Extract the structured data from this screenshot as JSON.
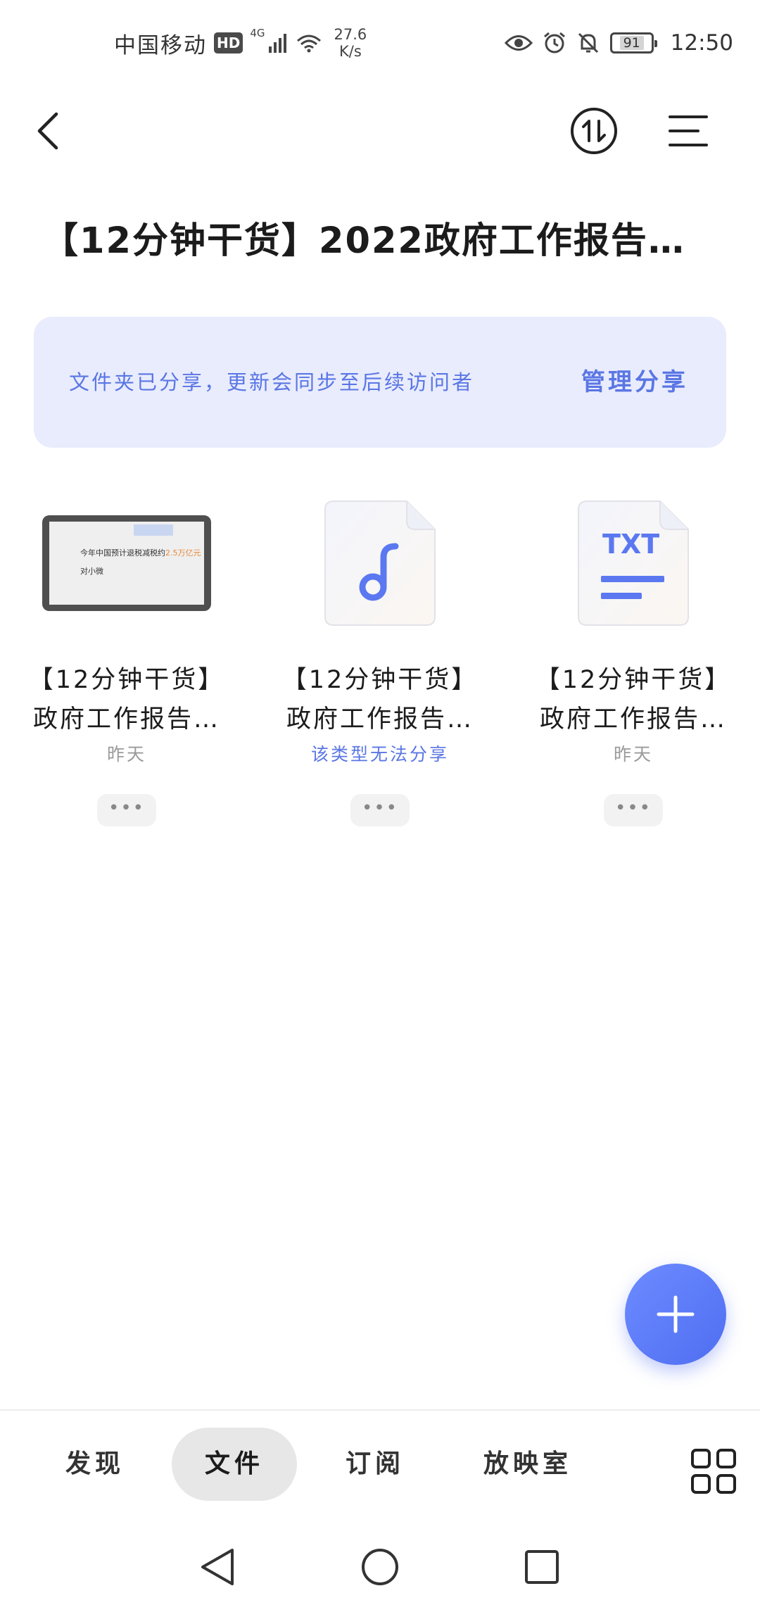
{
  "status_bar": {
    "carrier": "中国移动",
    "hd_label": "HD",
    "network_type": "4G",
    "speed_value": "27.6",
    "speed_unit": "K/s",
    "battery_level": "91",
    "time": "12:50"
  },
  "header": {
    "title": "【12分钟干货】2022政府工作报告…"
  },
  "share_banner": {
    "notice": "文件夹已分享，更新会同步至后续访问者",
    "manage_label": "管理分享"
  },
  "files": [
    {
      "type": "video",
      "name_line1": "【12分钟干货】",
      "name_line2": "政府工作报告…",
      "meta": "昨天",
      "thumb_text_1a": "今年中国预计退税减税约",
      "thumb_text_1b": "2.5万亿元",
      "thumb_text_2": "对小微"
    },
    {
      "type": "audio",
      "name_line1": "【12分钟干货】",
      "name_line2": "政府工作报告…",
      "meta": "该类型无法分享"
    },
    {
      "type": "txt",
      "name_line1": "【12分钟干货】",
      "name_line2": "政府工作报告…",
      "meta": "昨天",
      "icon_label": "TXT"
    }
  ],
  "more_label": "•••",
  "tabs": [
    {
      "label": "发现",
      "active": false
    },
    {
      "label": "文件",
      "active": true
    },
    {
      "label": "订阅",
      "active": false
    },
    {
      "label": "放映室",
      "active": false
    }
  ],
  "icons": {
    "back": "chevron-left-icon",
    "sort": "sort-arrows-icon",
    "menu": "menu-lines-icon",
    "add": "plus-icon",
    "grid": "grid-icon"
  },
  "colors": {
    "accent": "#5a76e4",
    "banner_bg": "#e9ecfd",
    "fab": "#5b7cf6"
  }
}
